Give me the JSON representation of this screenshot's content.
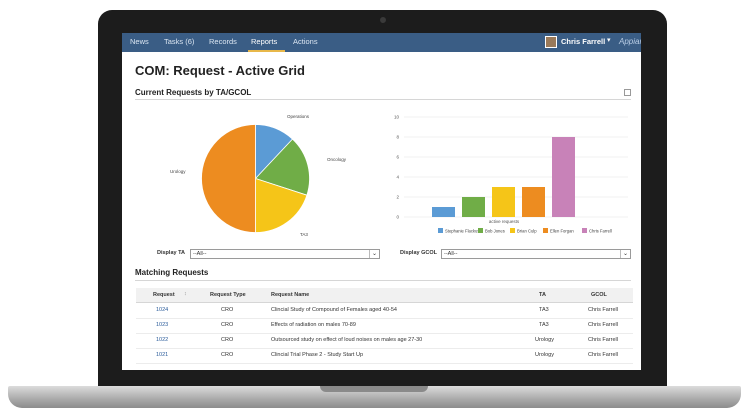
{
  "nav": {
    "tabs": [
      "News",
      "Tasks (6)",
      "Records",
      "Reports",
      "Actions"
    ],
    "active_tab": "Reports",
    "user": "Chris Farrell",
    "brand": "Appian"
  },
  "page": {
    "title": "COM: Request - Active Grid",
    "chart_section_title": "Current Requests by TA/GCOL",
    "grid_section_title": "Matching Requests"
  },
  "filters": {
    "ta_label": "Display TA",
    "ta_value": "--All--",
    "gcol_label": "Display GCOL",
    "gcol_value": "--All--"
  },
  "chart_data": [
    {
      "type": "pie",
      "slices": [
        {
          "label": "Operations",
          "value": 12,
          "color": "#5b9bd5"
        },
        {
          "label": "Oncology",
          "value": 18,
          "color": "#70ad47"
        },
        {
          "label": "TA3",
          "value": 20,
          "color": "#f5c518"
        },
        {
          "label": "Urology",
          "value": 50,
          "color": "#ed8c20"
        }
      ]
    },
    {
      "type": "bar",
      "xlabel": "active requests",
      "ylim": [
        0,
        10
      ],
      "yticks": [
        0,
        2,
        4,
        6,
        8,
        10
      ],
      "legend_position": "bottom",
      "series": [
        {
          "name": "Stephanie Flackus",
          "value": 1,
          "color": "#5b9bd5"
        },
        {
          "name": "Bob Jones",
          "value": 2,
          "color": "#70ad47"
        },
        {
          "name": "Brian Culp",
          "value": 3,
          "color": "#f5c518"
        },
        {
          "name": "Ellen Forgan",
          "value": 3,
          "color": "#ed8c20"
        },
        {
          "name": "Chris Farrell",
          "value": 8,
          "color": "#c882b8"
        }
      ]
    }
  ],
  "grid": {
    "columns": [
      "Request",
      "Request Type",
      "Request Name",
      "TA",
      "GCOL"
    ],
    "rows": [
      [
        "1024",
        "CRO",
        "Clincial Study of Compound of Females aged 40-54",
        "TA3",
        "Chris Farrell"
      ],
      [
        "1023",
        "CRO",
        "Effects of radiation on males 70-89",
        "TA3",
        "Chris Farrell"
      ],
      [
        "1022",
        "CRO",
        "Outsourced study on effect of loud noises on males age 27-30",
        "Urology",
        "Chris Farrell"
      ],
      [
        "1021",
        "CRO",
        "Clincial Trial Phase 2 - Study Start Up",
        "Urology",
        "Chris Farrell"
      ]
    ]
  }
}
